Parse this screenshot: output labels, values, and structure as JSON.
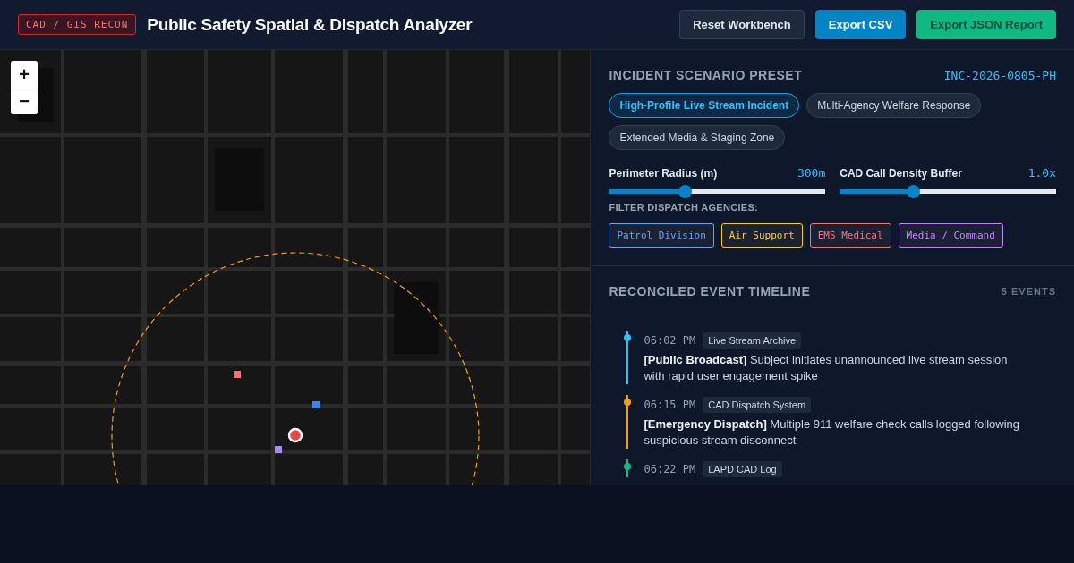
{
  "header": {
    "badge": "CAD / GIS RECON",
    "title": "Public Safety Spatial & Dispatch Analyzer",
    "buttons": [
      {
        "label": "Reset Workbench",
        "kind": "neutral"
      },
      {
        "label": "Export CSV",
        "kind": "primary"
      },
      {
        "label": "Export JSON Report",
        "kind": "success"
      }
    ]
  },
  "map": {
    "zoom_in": "+",
    "zoom_out": "−",
    "markers": [
      {
        "color": "#f87171"
      },
      {
        "color": "#3b82f6"
      },
      {
        "color": "#a78bfa"
      }
    ]
  },
  "scenario": {
    "title": "INCIDENT SCENARIO PRESET",
    "incident_id": "INC-2026-0805-PH",
    "presets": [
      {
        "label": "High-Profile Live Stream Incident",
        "selected": true
      },
      {
        "label": "Multi-Agency Welfare Response",
        "selected": false
      },
      {
        "label": "Extended Media & Staging Zone",
        "selected": false
      }
    ],
    "sliders": [
      {
        "label": "Perimeter Radius (m)",
        "reading": "300m",
        "level": 0.35
      },
      {
        "label": "CAD Call Density Buffer",
        "reading": "1.0x",
        "level": 0.34
      }
    ],
    "filter_label": "FILTER DISPATCH AGENCIES:",
    "agencies": [
      {
        "label": "Patrol Division",
        "color": "#60a5fa"
      },
      {
        "label": "Air Support",
        "color": "#facc15"
      },
      {
        "label": "EMS Medical",
        "color": "#f87171"
      },
      {
        "label": "Media / Command",
        "color": "#c084fc"
      }
    ]
  },
  "timeline": {
    "title": "RECONCILED EVENT TIMELINE",
    "count": "5 EVENTS",
    "events": [
      {
        "time": "06:02 PM",
        "source": "Live Stream Archive",
        "text": "**[Public Broadcast]** Subject initiates unannounced live stream session with rapid user engagement spike",
        "color": "#38bdf8"
      },
      {
        "time": "06:15 PM",
        "source": "CAD Dispatch System",
        "text": "**[Emergency Dispatch]** Multiple 911 welfare check calls logged following suspicious stream disconnect",
        "color": "#f59e0b"
      },
      {
        "time": "06:22 PM",
        "source": "LAPD CAD Log",
        "color": "#10b981"
      }
    ]
  }
}
